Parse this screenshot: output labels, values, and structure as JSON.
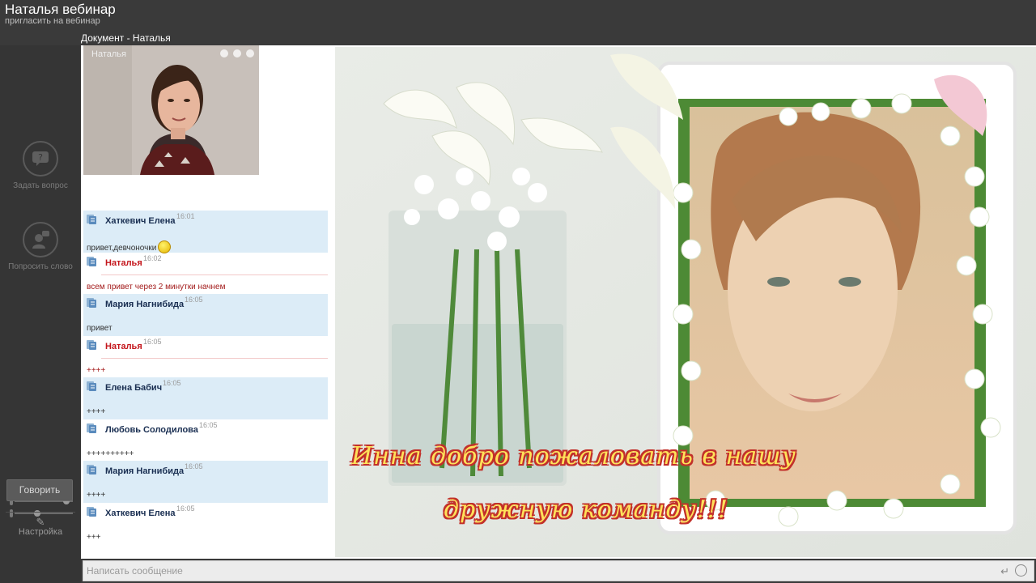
{
  "header": {
    "title": "Наталья вебинар",
    "subtitle": "пригласить на вебинар",
    "document_title": "Документ - Наталья"
  },
  "rail": {
    "ask_question_label": "Задать вопрос",
    "request_word_label": "Попросить слово",
    "speak_button": "Говорить",
    "settings_label": "Настройка"
  },
  "camera": {
    "name": "Наталья"
  },
  "chat": {
    "messages": [
      {
        "name": "Хаткевич Елена",
        "time": "16:01",
        "text": "привет,девчоночки",
        "style": "blue",
        "smiley": true
      },
      {
        "name": "Наталья",
        "time": "16:02",
        "text": "всем привет через 2 минутки начнем",
        "style": "host"
      },
      {
        "name": "Мария Нагнибида",
        "time": "16:05",
        "text": "привет",
        "style": "blue"
      },
      {
        "name": "Наталья",
        "time": "16:05",
        "text": "++++",
        "style": "host"
      },
      {
        "name": "Елена Бабич",
        "time": "16:05",
        "text": "++++",
        "style": "blue"
      },
      {
        "name": "Любовь Солодилова",
        "time": "16:05",
        "text": "++++++++++",
        "style": "white"
      },
      {
        "name": "Мария Нагнибида",
        "time": "16:05",
        "text": "++++",
        "style": "blue"
      },
      {
        "name": "Хаткевич Елена",
        "time": "16:05",
        "text": "+++",
        "style": "white"
      }
    ]
  },
  "document": {
    "caption_line1": "Инна добро пожаловать в нашу",
    "caption_line2": "дружную команду!!!"
  },
  "input": {
    "placeholder": "Написать сообщение"
  },
  "colors": {
    "host_name": "#c4161c",
    "user_name": "#1a2f52",
    "blue_row": "#dcecf7"
  }
}
